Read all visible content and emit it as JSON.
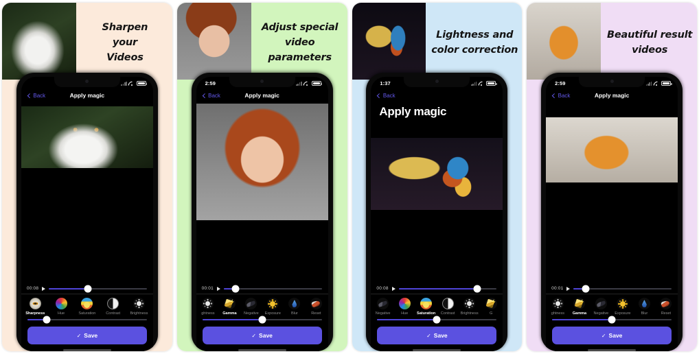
{
  "panels": [
    {
      "id": "panel-sharpen",
      "bg": "#FCEADB",
      "caption_lines": [
        "Sharpen",
        "your",
        "Videos"
      ],
      "hero_alt": "owl-thumbnail",
      "phone": {
        "status": {
          "time": "",
          "wifi": "wifi-icon",
          "battery": "battery-icon",
          "cellular": "cellular-icon"
        },
        "nav": {
          "back": "Back",
          "title": "Apply magic"
        },
        "large_title": "",
        "video_alt": "owl-video-preview",
        "scrub": {
          "time": "00:08",
          "fill_pct": 40,
          "knob_pct": 40
        },
        "filters": [
          {
            "label": "Sharpness",
            "icon": "sharpness-icon",
            "selected": true
          },
          {
            "label": "Hue",
            "icon": "hue-icon",
            "selected": false
          },
          {
            "label": "Saturation",
            "icon": "saturation-icon",
            "selected": false
          },
          {
            "label": "Contrast",
            "icon": "contrast-icon",
            "selected": false
          },
          {
            "label": "Brightness",
            "icon": "brightness-icon",
            "selected": false
          }
        ],
        "adjust": {
          "fill_pct": 16,
          "knob_pct": 16
        },
        "save": {
          "label": "Save",
          "check": "✓",
          "color": "#5b51e0"
        }
      }
    },
    {
      "id": "panel-adjust",
      "bg": "#D2F5BD",
      "caption_lines": [
        "Adjust special",
        "video",
        "parameters"
      ],
      "hero_alt": "woman-portrait-thumbnail",
      "phone": {
        "status": {
          "time": "2:59",
          "wifi": "wifi-icon",
          "battery": "battery-icon",
          "cellular": "cellular-icon"
        },
        "nav": {
          "back": "Back",
          "title": "Apply magic"
        },
        "large_title": "",
        "video_alt": "red-hair-woman-video-preview",
        "scrub": {
          "time": "00:01",
          "fill_pct": 12,
          "knob_pct": 12
        },
        "filters": [
          {
            "label": "ghtness",
            "icon": "brightness-icon",
            "selected": false
          },
          {
            "label": "Gamma",
            "icon": "gamma-icon",
            "selected": true
          },
          {
            "label": "Negative",
            "icon": "negative-icon",
            "selected": false
          },
          {
            "label": "Exposure",
            "icon": "exposure-icon",
            "selected": false
          },
          {
            "label": "Blur",
            "icon": "blur-icon",
            "selected": false
          },
          {
            "label": "Reset",
            "icon": "reset-icon",
            "selected": false
          }
        ],
        "adjust": {
          "fill_pct": 50,
          "knob_pct": 50
        },
        "save": {
          "label": "Save",
          "check": "✓",
          "color": "#5b51e0"
        }
      }
    },
    {
      "id": "panel-lightness",
      "bg": "#CFE7F7",
      "caption_lines": [
        "Lightness and",
        "color correction"
      ],
      "hero_alt": "macaw-parrot-thumbnail",
      "phone": {
        "status": {
          "time": "1:37",
          "wifi": "wifi-icon",
          "battery": "battery-icon",
          "cellular": "cellular-icon"
        },
        "nav": {
          "back": "Back",
          "title": ""
        },
        "large_title": "Apply magic",
        "video_alt": "macaw-parrot-video-preview",
        "scrub": {
          "time": "00:08",
          "fill_pct": 80,
          "knob_pct": 80
        },
        "filters": [
          {
            "label": "Negative",
            "icon": "negative-icon",
            "selected": false
          },
          {
            "label": "Hue",
            "icon": "hue-icon",
            "selected": false
          },
          {
            "label": "Saturation",
            "icon": "saturation-icon",
            "selected": true
          },
          {
            "label": "Contrast",
            "icon": "contrast-icon",
            "selected": false
          },
          {
            "label": "Brightness",
            "icon": "brightness-icon",
            "selected": false
          },
          {
            "label": "G",
            "icon": "gamma-icon",
            "selected": false
          }
        ],
        "adjust": {
          "fill_pct": 50,
          "knob_pct": 50
        },
        "save": {
          "label": "Save",
          "check": "✓",
          "color": "#5b51e0"
        }
      }
    },
    {
      "id": "panel-result",
      "bg": "#F0DDF5",
      "caption_lines": [
        "Beautiful result",
        "videos"
      ],
      "hero_alt": "tiger-thumbnail",
      "phone": {
        "status": {
          "time": "2:59",
          "wifi": "wifi-icon",
          "battery": "battery-icon",
          "cellular": "cellular-icon"
        },
        "nav": {
          "back": "Back",
          "title": "Apply magic"
        },
        "large_title": "",
        "video_alt": "tiger-video-preview",
        "scrub": {
          "time": "00:01",
          "fill_pct": 12,
          "knob_pct": 12
        },
        "filters": [
          {
            "label": "ghtness",
            "icon": "brightness-icon",
            "selected": false
          },
          {
            "label": "Gamma",
            "icon": "gamma-icon",
            "selected": true
          },
          {
            "label": "Negative",
            "icon": "negative-icon",
            "selected": false
          },
          {
            "label": "Exposure",
            "icon": "exposure-icon",
            "selected": false
          },
          {
            "label": "Blur",
            "icon": "blur-icon",
            "selected": false
          },
          {
            "label": "Reset",
            "icon": "reset-icon",
            "selected": false
          }
        ],
        "adjust": {
          "fill_pct": 50,
          "knob_pct": 50
        },
        "save": {
          "label": "Save",
          "check": "✓",
          "color": "#5b51e0"
        }
      }
    }
  ]
}
